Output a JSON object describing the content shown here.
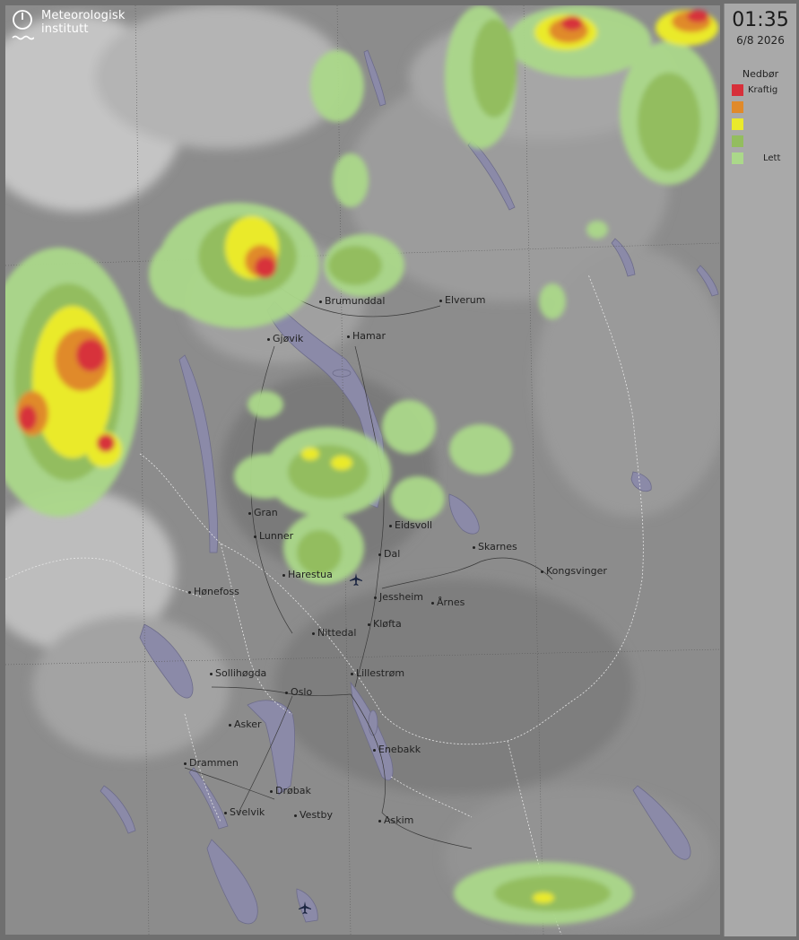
{
  "provider": {
    "line1": "Meteorologisk",
    "line2": "institutt",
    "logo_icon": "met-logo-icon"
  },
  "time": "01:35",
  "date": "6/8 2026",
  "legend": {
    "title": "Nedbør",
    "items": [
      {
        "label": "Kraftig",
        "color": "#d7303a"
      },
      {
        "label": "",
        "color": "#e08a2a"
      },
      {
        "label": "",
        "color": "#eaea2c"
      },
      {
        "label": "",
        "color": "#93bd5f"
      },
      {
        "label": "Lett",
        "color": "#abd88a"
      }
    ]
  },
  "cities": [
    "Brumunddal",
    "Elverum",
    "Gjøvik",
    "Hamar",
    "Eidsvoll",
    "Gran",
    "Skarnes",
    "Lunner",
    "Dal",
    "Kongsvinger",
    "Harestua",
    "Hønefoss",
    "Jessheim",
    "Årnes",
    "Kløfta",
    "Nittedal",
    "Sollihøgda",
    "Lillestrøm",
    "Oslo",
    "Asker",
    "Enebakk",
    "Drammen",
    "Drøbak",
    "Svelvik",
    "Vestby",
    "Askim"
  ],
  "icons": {
    "airport": "airport-icon"
  }
}
